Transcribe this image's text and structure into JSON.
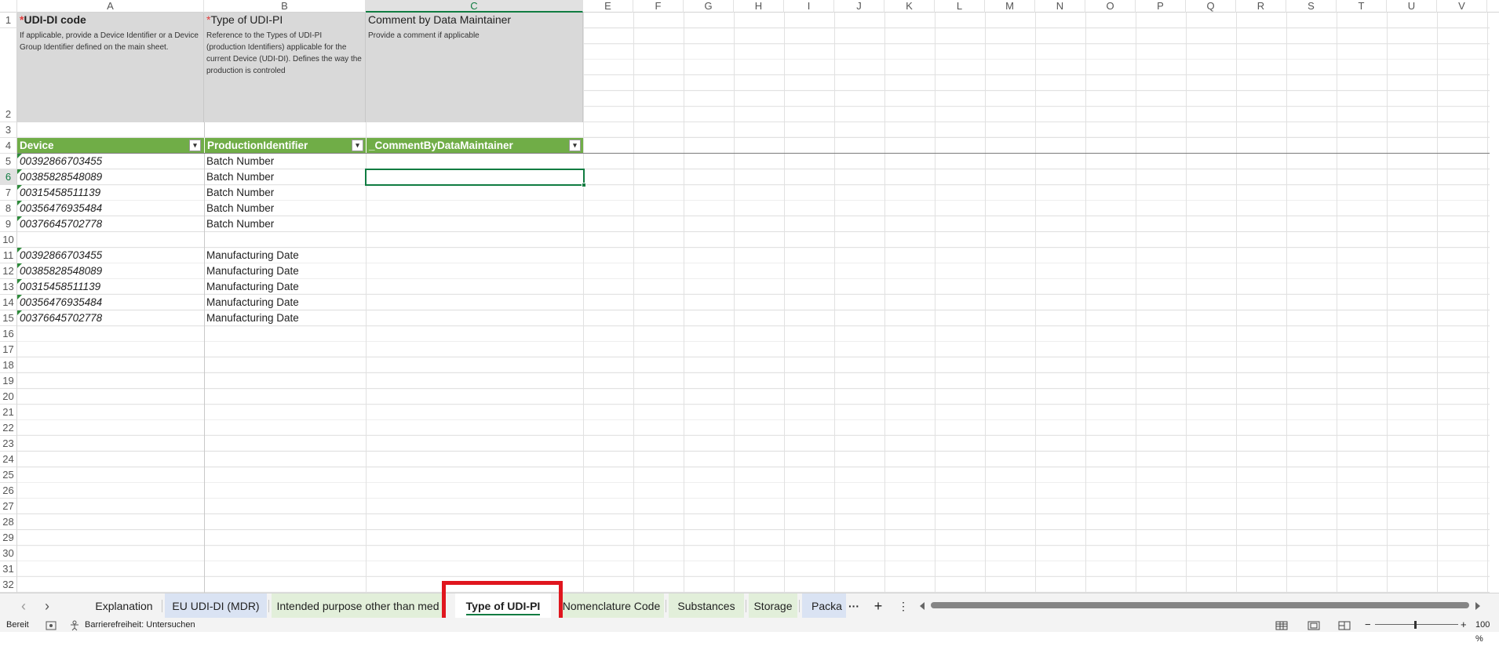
{
  "columns": [
    "A",
    "B",
    "C",
    "E",
    "F",
    "G",
    "H",
    "I",
    "J",
    "K",
    "L",
    "M",
    "N",
    "O",
    "P",
    "Q",
    "R",
    "S",
    "T",
    "U",
    "V"
  ],
  "selected_column": "C",
  "rows": [
    "1",
    "2",
    "3",
    "4",
    "5",
    "6",
    "7",
    "8",
    "9",
    "10",
    "11",
    "12",
    "13",
    "14",
    "15",
    "16",
    "17",
    "18",
    "19",
    "20",
    "21",
    "22",
    "23",
    "24",
    "25",
    "26",
    "27",
    "28",
    "29",
    "30",
    "31",
    "32"
  ],
  "selected_row": "6",
  "descriptions": {
    "a": {
      "required": "*",
      "title": "UDI-DI code",
      "text": "If applicable, provide a Device Identifier or a Device Group Identifier defined on the main sheet."
    },
    "b": {
      "required": "*",
      "title": "Type of UDI-PI",
      "text": "Reference to the Types of UDI-PI (production Identifiers) applicable for the current Device (UDI-DI). Defines the way the production is controled"
    },
    "c": {
      "title": "Comment by Data Maintainer",
      "text": "Provide a comment if applicable"
    }
  },
  "table_headers": [
    "Device",
    "ProductionIdentifier",
    "_CommentByDataMaintainer"
  ],
  "filter_glyph": "▾",
  "table_rows": [
    {
      "device": "00392866703455",
      "identifier": "Batch Number"
    },
    {
      "device": "00385828548089",
      "identifier": "Batch Number"
    },
    {
      "device": "00315458511139",
      "identifier": "Batch Number"
    },
    {
      "device": "00356476935484",
      "identifier": "Batch Number"
    },
    {
      "device": "00376645702778",
      "identifier": "Batch Number"
    },
    {
      "device": "",
      "identifier": ""
    },
    {
      "device": "00392866703455",
      "identifier": "Manufacturing Date"
    },
    {
      "device": "00385828548089",
      "identifier": "Manufacturing Date"
    },
    {
      "device": "00315458511139",
      "identifier": "Manufacturing Date"
    },
    {
      "device": "00356476935484",
      "identifier": "Manufacturing Date"
    },
    {
      "device": "00376645702778",
      "identifier": "Manufacturing Date"
    }
  ],
  "tabs": {
    "prev": "‹",
    "next": "›",
    "items": [
      "Explanation",
      "EU UDI-DI (MDR)",
      "Intended purpose other than med",
      "Type of UDI-PI",
      "Nomenclature Code",
      "Substances",
      "Storage",
      "Packa"
    ],
    "active": "Type of UDI-PI",
    "more": "···",
    "add": "+",
    "options": "⋮"
  },
  "status": {
    "ready": "Bereit",
    "accessibility": "Barrierefreiheit: Untersuchen",
    "zoom": "100 %",
    "zoom_minus": "−",
    "zoom_plus": "+",
    "zoom_level_percent": 100
  },
  "colors": {
    "table_header": "#70ad47",
    "accent": "#107c41",
    "highlight": "#e0161e"
  }
}
